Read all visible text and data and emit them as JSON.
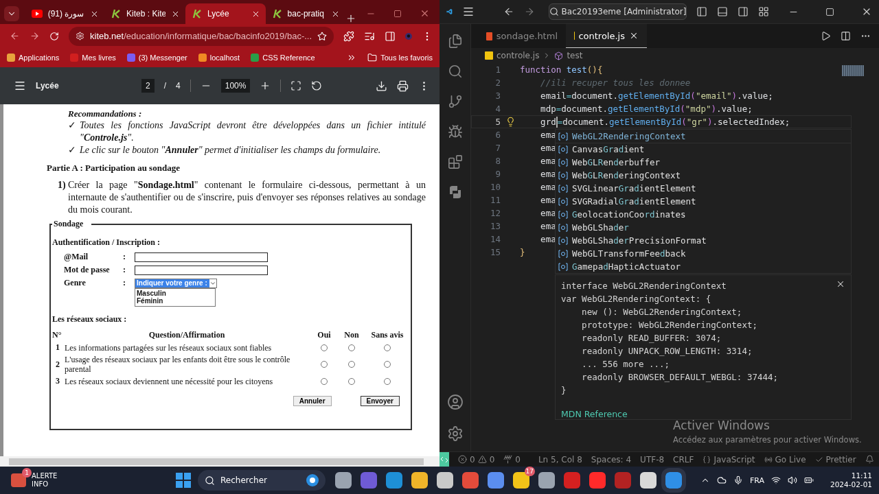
{
  "browser": {
    "tabs": [
      {
        "title": "(91) سورة",
        "selected": false
      },
      {
        "title": "Kiteb : Kite",
        "selected": false
      },
      {
        "title": "Lycée",
        "selected": true
      },
      {
        "title": "bac-pratiq",
        "selected": false
      }
    ],
    "url": {
      "host": "kiteb.net",
      "path": "/education/informatique/bac/bacinfo2019/bac-..."
    },
    "bookmarks": [
      "Applications",
      "Mes livres",
      "(3) Messenger",
      "localhost",
      "CSS Reference"
    ],
    "all_bookmarks": "Tous les favoris"
  },
  "pdf_viewer": {
    "title": "Lycée",
    "page": "2",
    "page_separator": "/",
    "page_count": "4",
    "zoom": "100%"
  },
  "document": {
    "recommendations_title": "Recommandations :",
    "recommendations": [
      {
        "bullet": "✓",
        "text": "Toutes les fonctions JavaScript devront être développées dans un fichier intitulé \"**Controle.js**\"."
      },
      {
        "bullet": "✓",
        "text": "Le clic sur le bouton \"**Annuler**\" permet d'initialiser les champs du formulaire."
      }
    ],
    "section_title": "Partie A : Participation au sondage",
    "question_number": "1)",
    "question": "Créer la page \"**Sondage.html**\" contenant le formulaire ci-dessous, permettant à un internaute de s'authentifier ou de s'inscrire, puis d'envoyer ses réponses relatives au sondage du mois courant.",
    "form": {
      "legend": "Sondage",
      "auth_title": "Authentification / Inscription :",
      "fields": [
        {
          "label": "@Mail",
          "colon": ":",
          "kind": "text"
        },
        {
          "label": "Mot de passe",
          "colon": ":",
          "kind": "text"
        },
        {
          "label": "Genre",
          "colon": ":",
          "kind": "select",
          "value": "Indiquer votre genre :",
          "options": [
            "Masculin",
            "Féminin"
          ]
        }
      ],
      "social_title": "Les réseaux sociaux :",
      "columns": [
        "N°",
        "Question/Affirmation",
        "Oui",
        "Non",
        "Sans avis"
      ],
      "rows": [
        {
          "number": "1",
          "text": "Les informations partagées sur les réseaux sociaux  sont fiables",
          "answers": [
            {
              "selected": false
            },
            {
              "selected": false
            },
            {
              "selected": false
            }
          ]
        },
        {
          "number": "2",
          "text": "L'usage des réseaux sociaux par les enfants doit être sous le contrôle parental",
          "answers": [
            {
              "selected": false
            },
            {
              "selected": false
            },
            {
              "selected": false
            }
          ]
        },
        {
          "number": "3",
          "text": "Les réseaux sociaux deviennent une nécessité pour les citoyens",
          "answers": [
            {
              "selected": false
            },
            {
              "selected": false
            },
            {
              "selected": false
            }
          ]
        }
      ],
      "buttons": [
        {
          "label": "Annuler",
          "kind": "reset"
        },
        {
          "label": "Envoyer",
          "kind": "submit"
        }
      ]
    }
  },
  "vscode": {
    "title": "Bac20193eme [Administrator]",
    "tabs": [
      {
        "label": "sondage.html",
        "selected": false
      },
      {
        "label": "controle.js",
        "selected": true
      }
    ],
    "breadcrumb": [
      "controle.js",
      "test"
    ],
    "lines": [
      {
        "number": "1",
        "current": false,
        "cursor": false,
        "tokens": [
          {
            "text": "function ",
            "kind": "keyword"
          },
          {
            "text": "test",
            "kind": "function"
          },
          {
            "text": "(){",
            "kind": "bracket"
          }
        ]
      },
      {
        "number": "2",
        "current": false,
        "cursor": false,
        "tokens": [
          {
            "text": "    //ili recuper tous les donnee",
            "kind": "comment"
          }
        ]
      },
      {
        "number": "3",
        "current": false,
        "cursor": false,
        "tokens": [
          {
            "text": "    email",
            "kind": "plain"
          },
          {
            "text": "=",
            "kind": "operator"
          },
          {
            "text": "document.",
            "kind": "plain"
          },
          {
            "text": "getElementById",
            "kind": "method"
          },
          {
            "text": "(",
            "kind": "bracket2"
          },
          {
            "text": "\"email\"",
            "kind": "string"
          },
          {
            "text": ")",
            "kind": "bracket2"
          },
          {
            "text": ".value;",
            "kind": "plain"
          }
        ]
      },
      {
        "number": "4",
        "current": false,
        "cursor": false,
        "tokens": [
          {
            "text": "    mdp",
            "kind": "plain"
          },
          {
            "text": "=",
            "kind": "operator"
          },
          {
            "text": "document.",
            "kind": "plain"
          },
          {
            "text": "getElementById",
            "kind": "method"
          },
          {
            "text": "(",
            "kind": "bracket2"
          },
          {
            "text": "\"mdp\"",
            "kind": "string"
          },
          {
            "text": ")",
            "kind": "bracket2"
          },
          {
            "text": ".value;",
            "kind": "plain"
          }
        ]
      },
      {
        "number": "5",
        "current": true,
        "cursor": true,
        "tokens": [
          {
            "text": "    grd",
            "kind": "plain"
          },
          {
            "text": "=",
            "kind": "operator"
          },
          {
            "text": "document.",
            "kind": "plain"
          },
          {
            "text": "getElementById",
            "kind": "method"
          },
          {
            "text": "(",
            "kind": "bracket2"
          },
          {
            "text": "\"gr\"",
            "kind": "string"
          },
          {
            "text": ")",
            "kind": "bracket2"
          },
          {
            "text": ".selectedIndex;",
            "kind": "plain"
          }
        ]
      },
      {
        "number": "6",
        "current": false,
        "cursor": false,
        "tokens": [
          {
            "text": "    ema",
            "kind": "plain"
          }
        ]
      },
      {
        "number": "7",
        "current": false,
        "cursor": false,
        "tokens": [
          {
            "text": "    ema",
            "kind": "plain"
          }
        ]
      },
      {
        "number": "8",
        "current": false,
        "cursor": false,
        "tokens": [
          {
            "text": "    ema",
            "kind": "plain"
          }
        ]
      },
      {
        "number": "9",
        "current": false,
        "cursor": false,
        "tokens": [
          {
            "text": "    ema",
            "kind": "plain"
          }
        ]
      },
      {
        "number": "10",
        "current": false,
        "cursor": false,
        "tokens": [
          {
            "text": "    ema",
            "kind": "plain"
          }
        ]
      },
      {
        "number": "11",
        "current": false,
        "cursor": false,
        "tokens": [
          {
            "text": "    ema",
            "kind": "plain"
          }
        ]
      },
      {
        "number": "12",
        "current": false,
        "cursor": false,
        "tokens": [
          {
            "text": "    ema",
            "kind": "plain"
          }
        ]
      },
      {
        "number": "13",
        "current": false,
        "cursor": false,
        "tokens": [
          {
            "text": "    ema",
            "kind": "plain"
          }
        ]
      },
      {
        "number": "14",
        "current": false,
        "cursor": false,
        "tokens": [
          {
            "text": "    ema",
            "kind": "plain"
          }
        ]
      },
      {
        "number": "15",
        "current": false,
        "cursor": false,
        "tokens": [
          {
            "text": "}",
            "kind": "bracket"
          }
        ]
      }
    ],
    "suggestions": [
      {
        "label": "Web**G**L2**R**en**d**eringContext",
        "selected": true
      },
      {
        "label": "Canvas**Gr**a**d**ient",
        "selected": false
      },
      {
        "label": "Web**G**L**R**en**d**erbuffer",
        "selected": false
      },
      {
        "label": "Web**G**L**R**en**d**eringContext",
        "selected": false
      },
      {
        "label": "SVGLinear**Gr**a**d**ientElement",
        "selected": false
      },
      {
        "label": "SVGRadial**Gr**a**d**ientElement",
        "selected": false
      },
      {
        "label": "**G**eolocationCoo**rd**inates",
        "selected": false
      },
      {
        "label": "WebGLSha**d**e**r**",
        "selected": false
      },
      {
        "label": "WebGLSha**d**e**r**PrecisionFormat",
        "selected": false
      },
      {
        "label": "WebGLTransformFee**d**back",
        "selected": false
      },
      {
        "label": "**G**amepa**d**HapticActuator",
        "selected": false
      }
    ],
    "hover": {
      "lines": [
        "interface WebGL2RenderingContext",
        "var WebGL2RenderingContext: {",
        "    new (): WebGL2RenderingContext;",
        "    prototype: WebGL2RenderingContext;",
        "    readonly READ_BUFFER: 3074;",
        "    readonly UNPACK_ROW_LENGTH: 3314;",
        "    ... 556 more ...;",
        "    readonly BROWSER_DEFAULT_WEBGL: 37444;",
        "}"
      ],
      "link": "MDN Reference"
    },
    "status": {
      "errors": "0",
      "warnings": "0",
      "ports": "0",
      "items": [
        "Ln 5, Col 8",
        "Spaces: 4",
        "UTF-8",
        "CRLF",
        "JavaScript",
        "Go Live",
        "Prettier"
      ]
    },
    "activation": {
      "title": "Activer Windows",
      "text": "Accédez aux paramètres pour activer Windows."
    }
  },
  "taskbar": {
    "alert": {
      "badge": "1",
      "title": "ALERTE",
      "subtitle": "INFO"
    },
    "search": "Rechercher",
    "app_badge": "17",
    "language": "FRA",
    "time": "11:11",
    "date": "2024-02-01"
  }
}
